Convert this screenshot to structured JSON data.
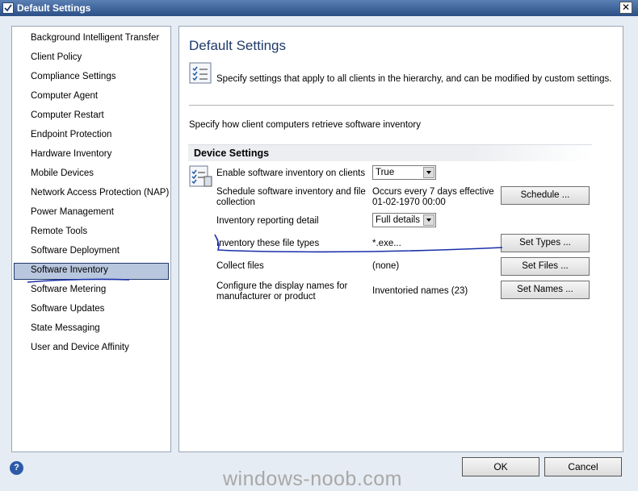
{
  "window": {
    "title": "Default Settings",
    "close_glyph": "✕"
  },
  "sidebar": {
    "items": [
      {
        "label": "Background Intelligent Transfer"
      },
      {
        "label": "Client Policy"
      },
      {
        "label": "Compliance Settings"
      },
      {
        "label": "Computer Agent"
      },
      {
        "label": "Computer Restart"
      },
      {
        "label": "Endpoint Protection"
      },
      {
        "label": "Hardware Inventory"
      },
      {
        "label": "Mobile Devices"
      },
      {
        "label": "Network Access Protection (NAP)"
      },
      {
        "label": "Power Management"
      },
      {
        "label": "Remote Tools"
      },
      {
        "label": "Software Deployment"
      },
      {
        "label": "Software Inventory",
        "selected": true
      },
      {
        "label": "Software Metering"
      },
      {
        "label": "Software Updates"
      },
      {
        "label": "State Messaging"
      },
      {
        "label": "User and Device Affinity"
      }
    ]
  },
  "main": {
    "heading": "Default Settings",
    "description": "Specify settings that apply to all clients in the hierarchy, and can be modified by custom settings.",
    "subtitle": "Specify how client computers retrieve software inventory",
    "section_title": "Device Settings",
    "settings": {
      "enable": {
        "label": "Enable software inventory on clients",
        "value": "True"
      },
      "schedule": {
        "label_line1": "Schedule software inventory and file",
        "label_line2": "collection",
        "value_line1": "Occurs every 7 days effective",
        "value_line2": "01-02-1970 00:00",
        "button": "Schedule ..."
      },
      "reporting": {
        "label": "Inventory reporting detail",
        "value": "Full details"
      },
      "file_types": {
        "label": "Inventory these file types",
        "value": "*.exe...",
        "button": "Set Types ..."
      },
      "collect": {
        "label": "Collect files",
        "value": "(none)",
        "button": "Set Files ..."
      },
      "names": {
        "label_line1": "Configure the display names for",
        "label_line2": "manufacturer or product",
        "value": "Inventoried names (23)",
        "button": "Set Names ..."
      }
    }
  },
  "footer": {
    "help_glyph": "?",
    "ok": "OK",
    "cancel": "Cancel"
  },
  "watermark": "windows-noob.com",
  "colors": {
    "titlebar": "#2b4f86",
    "selection": "#b8c6de",
    "annotation_ink": "#1a2fa8"
  }
}
